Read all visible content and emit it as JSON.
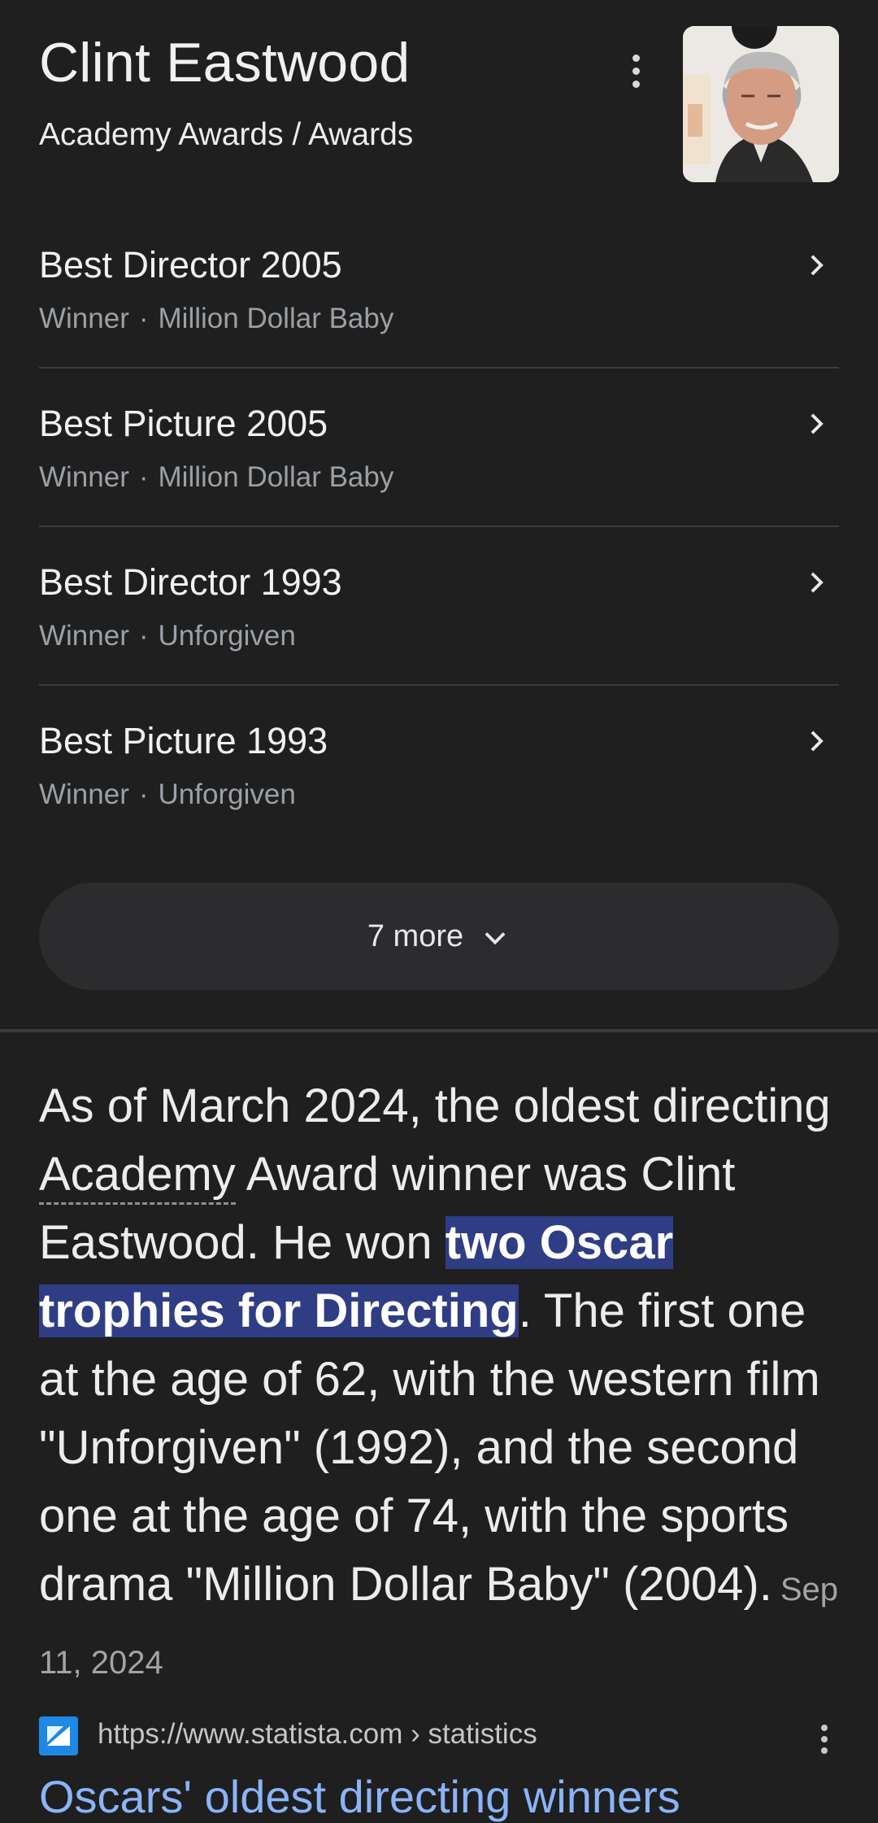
{
  "header": {
    "title": "Clint Eastwood",
    "subtitle": "Academy Awards / Awards",
    "menu_icon": "more-vert-icon",
    "photo_icon": "person-photo"
  },
  "awards": [
    {
      "title": "Best Director 2005",
      "status": "Winner",
      "separator": "·",
      "film": "Million Dollar Baby"
    },
    {
      "title": "Best Picture 2005",
      "status": "Winner",
      "separator": "·",
      "film": "Million Dollar Baby"
    },
    {
      "title": "Best Director 1993",
      "status": "Winner",
      "separator": "·",
      "film": "Unforgiven"
    },
    {
      "title": "Best Picture 1993",
      "status": "Winner",
      "separator": "·",
      "film": "Unforgiven"
    }
  ],
  "more_button": {
    "label": "7 more"
  },
  "snippet": {
    "part1": "As of March 2024, the oldest directing ",
    "dotted": "Academy",
    "part2": " Award winner was Clint Eastwood. He won ",
    "highlight": "two Oscar trophies for Directing",
    "part3": ". The first one at the age of 62, with the western film \"Unforgiven\" (1992), and the second one at the age of 74, with the sports drama \"Million Dollar Baby\" (2004).",
    "date": "Sep 11, 2024"
  },
  "source": {
    "url": "https://www.statista.com › statistics",
    "title": "Oscars' oldest directing winners"
  },
  "colors": {
    "background": "#1f1f1f",
    "highlight": "#2f3d85",
    "link": "#8ab4f8",
    "favicon": "#1e88e5"
  }
}
